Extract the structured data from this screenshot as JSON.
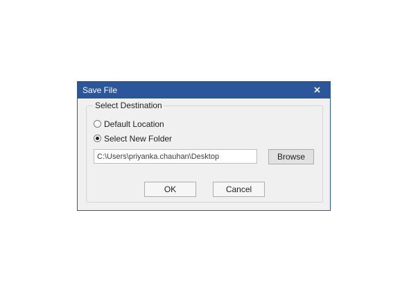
{
  "dialog": {
    "title": "Save File",
    "close_glyph": "close-icon",
    "titlebar_color": "#2b579a"
  },
  "destination": {
    "legend": "Select Destination",
    "options": [
      {
        "label": "Default Location",
        "selected": false
      },
      {
        "label": "Select New Folder",
        "selected": true
      }
    ],
    "path_value": "C:\\Users\\priyanka.chauhan\\Desktop",
    "browse_label": "Browse"
  },
  "actions": {
    "ok_label": "OK",
    "cancel_label": "Cancel"
  }
}
